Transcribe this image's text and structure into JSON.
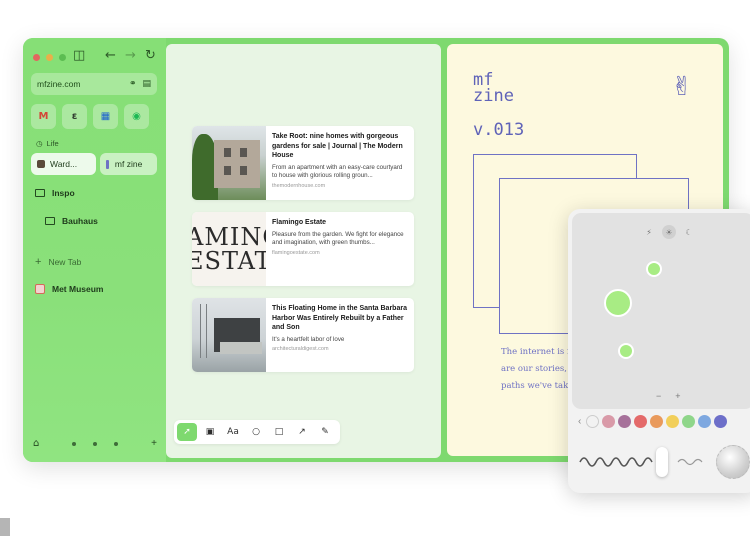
{
  "sidebar": {
    "url": "mfzine.com",
    "favorites": [
      {
        "name": "gmail",
        "glyph": "M"
      },
      {
        "name": "notion",
        "glyph": "ɛ"
      },
      {
        "name": "calendar",
        "glyph": "▦"
      },
      {
        "name": "spotify",
        "glyph": "◉"
      }
    ],
    "space_label": "Life",
    "split_tabs": [
      "Ward...",
      "mf zine"
    ],
    "items": [
      {
        "label": "Inspo"
      },
      {
        "label": "Bauhaus"
      },
      {
        "label": "New Tab"
      },
      {
        "label": "Met Museum"
      }
    ]
  },
  "cards": [
    {
      "title": "Take Root: nine homes with gorgeous gardens for sale | Journal | The Modern House",
      "desc": "From an apartment with an easy-care courtyard to house with glorious rolling groun...",
      "source": "themodernhouse.com"
    },
    {
      "title": "Flamingo Estate",
      "desc": "Pleasure from the garden. We fight for elegance and imagination, with green thumbs...",
      "source": "flamingoestate.com",
      "thumb_text": [
        "AMINGO",
        "ESTATE"
      ]
    },
    {
      "title": "This Floating Home in the Santa Barbara Harbor Was Entirely Rebuilt by a Father and Son",
      "desc": "It's a heartfelt labor of love",
      "source": "architecturaldigest.com"
    }
  ],
  "toolbar": {
    "tools": [
      "cursor",
      "image",
      "Aa",
      "circle",
      "square",
      "arrow",
      "pen"
    ]
  },
  "zine": {
    "title_line1": "mf",
    "title_line2": "zine",
    "version": "v.013",
    "body_line1": "The internet is f",
    "body_line2": "are our stories, v",
    "body_line3": "paths we've take"
  },
  "palette": {
    "swatch_colors": [
      "#f2f2f2",
      "#d99aa8",
      "#a6719a",
      "#e46a6a",
      "#e99a5c",
      "#f2cf5a",
      "#8fd68a",
      "#7ea8e0",
      "#6d6fc9"
    ],
    "zoom_minus": "−",
    "zoom_plus": "+"
  }
}
